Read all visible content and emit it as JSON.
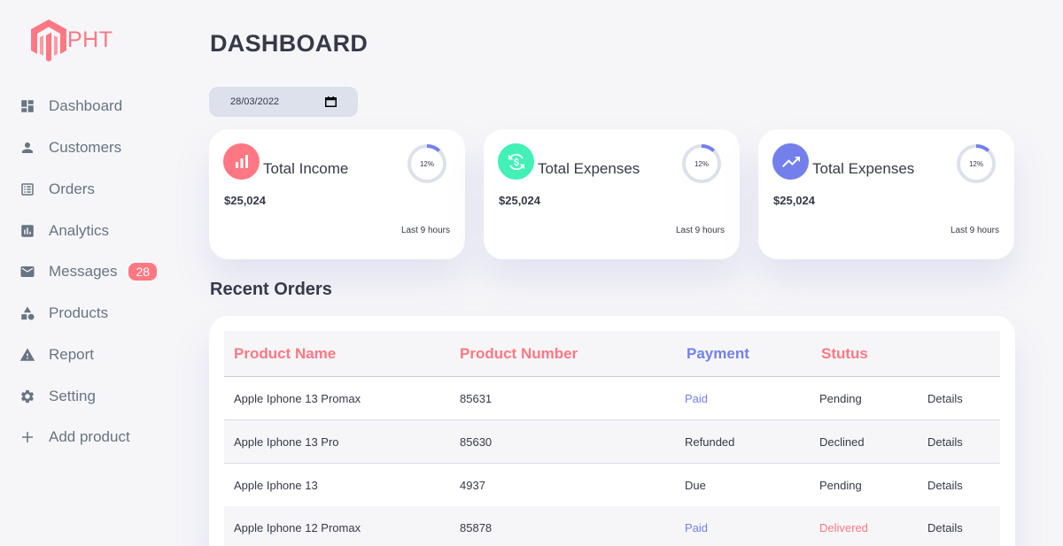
{
  "brand": {
    "name": "PHT",
    "color": "#ff7782"
  },
  "sidebar": {
    "items": [
      {
        "label": "Dashboard",
        "icon": "dashboard-icon"
      },
      {
        "label": "Customers",
        "icon": "person-icon"
      },
      {
        "label": "Orders",
        "icon": "receipt-icon"
      },
      {
        "label": "Analytics",
        "icon": "insights-icon"
      },
      {
        "label": "Messages",
        "icon": "mail-icon",
        "badge": "28"
      },
      {
        "label": "Products",
        "icon": "category-icon"
      },
      {
        "label": "Report",
        "icon": "warning-icon"
      },
      {
        "label": "Setting",
        "icon": "gear-icon"
      },
      {
        "label": "Add product",
        "icon": "plus-icon"
      }
    ]
  },
  "header": {
    "title": "DASHBOARD",
    "date": "28/03/2022"
  },
  "cards": [
    {
      "label": "Total Income",
      "amount": "$25,024",
      "progress": "12%",
      "footer": "Last 9 hours",
      "icon": "bar-chart-icon",
      "color": "#ff7782"
    },
    {
      "label": "Total Expenses",
      "amount": "$25,024",
      "progress": "12%",
      "footer": "Last 9 hours",
      "icon": "currency-exchange-icon",
      "color": "#41f1b6"
    },
    {
      "label": "Total Expenses",
      "amount": "$25,024",
      "progress": "12%",
      "footer": "Last 9 hours",
      "icon": "trending-up-icon",
      "color": "#7380ec"
    }
  ],
  "recent_orders": {
    "title": "Recent Orders",
    "columns": [
      "Product Name",
      "Product Number",
      "Payment",
      "Stutus"
    ],
    "rows": [
      {
        "name": "Apple Iphone 13 Promax",
        "number": "85631",
        "payment": "Paid",
        "status": "Pending",
        "action": "Details"
      },
      {
        "name": "Apple Iphone 13 Pro",
        "number": "85630",
        "payment": "Refunded",
        "status": "Declined",
        "action": "Details"
      },
      {
        "name": "Apple Iphone 13",
        "number": "4937",
        "payment": "Due",
        "status": "Pending",
        "action": "Details"
      },
      {
        "name": "Apple Iphone 12 Promax",
        "number": "85878",
        "payment": "Paid",
        "status": "Delivered",
        "action": "Details"
      }
    ]
  },
  "colors": {
    "primary": "#7380ec",
    "danger": "#ff7782",
    "success": "#41f1b6",
    "text": "#363949",
    "muted": "#677483"
  }
}
